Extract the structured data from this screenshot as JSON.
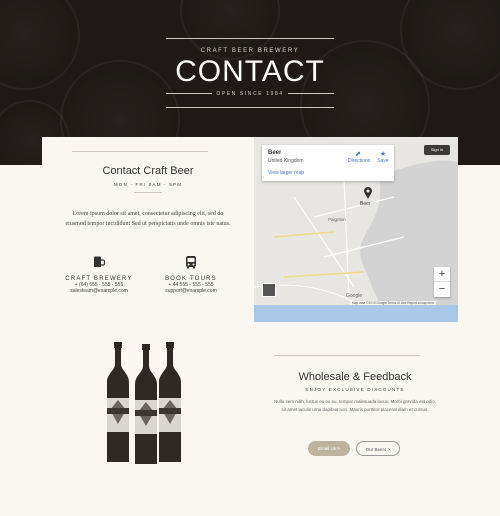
{
  "hero": {
    "kicker": "CRAFT BEER BREWERY",
    "title": "CONTACT",
    "subtitle": "OPEN SINCE 1984"
  },
  "contact": {
    "heading": "Contact Craft Beer",
    "hours": "MON - FRI 8AM - 5PM",
    "body": "Lorem ipsum dolor sit amet, consectetur adipiscing elit, sed do eiusmod tempor incididunt Sed ut perspiciatis unde omnis iste natus.",
    "brewery": {
      "title": "CRAFT BREWERY",
      "phone": "+ (64) 555 - 555 - 555",
      "email": "salesteam@example.com",
      "icon": "beer-mug-icon"
    },
    "tours": {
      "title": "BOOK TOURS",
      "phone": "+ 44 555 - 555 - 555",
      "email": "support@example.com",
      "icon": "bus-icon"
    }
  },
  "map": {
    "popup_title": "Beer",
    "popup_subtitle": "United Kingdom",
    "popup_link": "View larger map",
    "directions": "Directions",
    "save": "Save",
    "fullscreen": "Sign in",
    "pin_label": "Beer",
    "place": "Paignton",
    "google": "Google",
    "footer": "Map data ©2019 Google  Terms of Use  Report a map error",
    "zoom_in": "+",
    "zoom_out": "−"
  },
  "wholesale": {
    "title": "Wholesale & Feedback",
    "subtitle": "ENJOY EXCLUSIVE DISCOUNTS",
    "body": "Nulla sem nibh, luctus eu ex eu, tempor malesuada lacus. Morbi gravida est odio, sit amet iaculis urna dapibus non. Mauris porttitor placerat diam et cursus.",
    "email_button": "Email Us  >",
    "beers_button": "Our Beers  >"
  },
  "colors": {
    "hero_bg": "#1f1a17",
    "page_bg": "#faf7f3",
    "accent": "#bdb39f"
  }
}
